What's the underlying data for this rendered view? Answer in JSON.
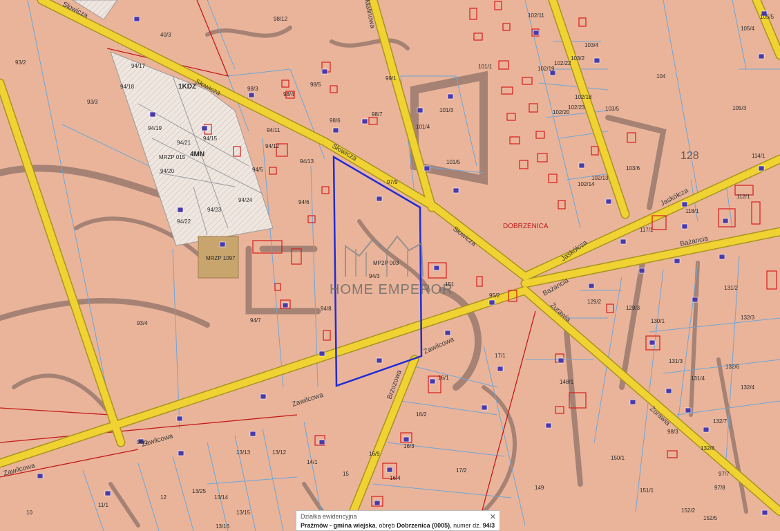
{
  "map": {
    "place_name": "DOBRZENICA",
    "watermark": "HOME EMPEROR",
    "streets": {
      "slowicza": "Słowicza",
      "zawilcowa": "Zawilcowa",
      "jaskolcza": "Jaskółcza",
      "bazancia": "Bażancia",
      "zurawia": "Żurawia",
      "brzozowa": "Brzozowa",
      "malinowa": "Malinowa"
    },
    "zones": {
      "mrzp1": "MRZP 015",
      "mrzp2": "MRZP 1097",
      "mp2p": "MP2P 003",
      "tkdz": "1KDZ",
      "mn": "4MN",
      "num128": "128"
    },
    "parcels": {
      "p93_2": "93/2",
      "p93_3": "93/3",
      "p93_4": "93/4",
      "p98_12": "98/12",
      "p98_3": "98/3",
      "p98_4": "98/4",
      "p98_5": "98/5",
      "p98_6": "98/6",
      "p98_7": "98/7",
      "p99_1": "99/1",
      "p101_1": "101/1",
      "p101_3": "101/3",
      "p101_4": "101/4",
      "p101_5": "101/5",
      "p102_11": "102/11",
      "p102_22": "102/22",
      "p102_19": "102/19",
      "p102_18": "102/18",
      "p102_23": "102/23",
      "p102_20": "102/20",
      "p102_13": "102/13",
      "p102_14": "102/14",
      "p103_4": "103/4",
      "p103_2": "103/2",
      "p103_5": "103/5",
      "p103_6": "103/6",
      "p104": "104",
      "p105_4": "105/4",
      "p105_3": "105/3",
      "p105_5": "105/5",
      "p114_1": "114/1",
      "p112_1": "112/1",
      "p118_1": "118/1",
      "p117_1": "117/1",
      "p40_3": "40/3",
      "p94_17": "94/17",
      "p94_18": "94/18",
      "p94_19": "94/19",
      "p94_15": "94/15",
      "p94_21": "94/21",
      "p94_20": "94/20",
      "p94_11": "94/11",
      "p94_12": "94/12",
      "p94_13": "94/13",
      "p94_5": "94/5",
      "p94_6": "94/6",
      "p94_23": "94/23",
      "p94_24": "94/24",
      "p94_22": "94/22",
      "p94_3": "94/3",
      "p94_8": "94/8",
      "p94_7": "94/7",
      "p97_9": "97/9",
      "p95_2": "95/2",
      "p129_2": "129/2",
      "p129_3": "129/3",
      "p131_2": "131/2",
      "p132_3": "132/3",
      "p130_1": "130/1",
      "p131_3": "131/3",
      "p131_4": "131/4",
      "p132_6": "132/6",
      "p132_4": "132/4",
      "p132_7": "132/7",
      "p132_8": "132/8",
      "p148_1": "148/1",
      "p17_1": "17/1",
      "p16_1": "16/1",
      "p16_2": "16/2",
      "p16_3": "16/3",
      "p16_9": "16/9",
      "p16_4": "16/4",
      "p17_2": "17/2",
      "p150_1": "150/1",
      "p151_1": "151/1",
      "p149": "149",
      "p96_1": "96/1",
      "p13_13": "13/13",
      "p13_12": "13/12",
      "p14_1": "14/1",
      "p13_25": "13/25",
      "p13_14": "13/14",
      "p13_15": "13/15",
      "p13_16": "13/16",
      "p11_1": "11/1",
      "p12": "12",
      "p10": "10",
      "p15": "15",
      "p98_3b": "98/3",
      "p97_7": "97/7",
      "p97_8": "97/8",
      "p152_2": "152/2",
      "p152_5": "152/5",
      "p151": "151"
    }
  },
  "popup": {
    "title": "Działka ewidencyjna",
    "place": "Prażmów - gmina wiejska",
    "rest": ", obręb ",
    "precinct": "Dobrzenica (0005)",
    "number_prefix": ", numer dz. ",
    "number": "94/3",
    "close": "✕"
  },
  "colors": {
    "background": "#e9b49a",
    "road": "#f0d232",
    "selected_parcel": "#1f2bd6",
    "parcel_lines": "#6ea6d8",
    "building": "#d61c1c"
  }
}
